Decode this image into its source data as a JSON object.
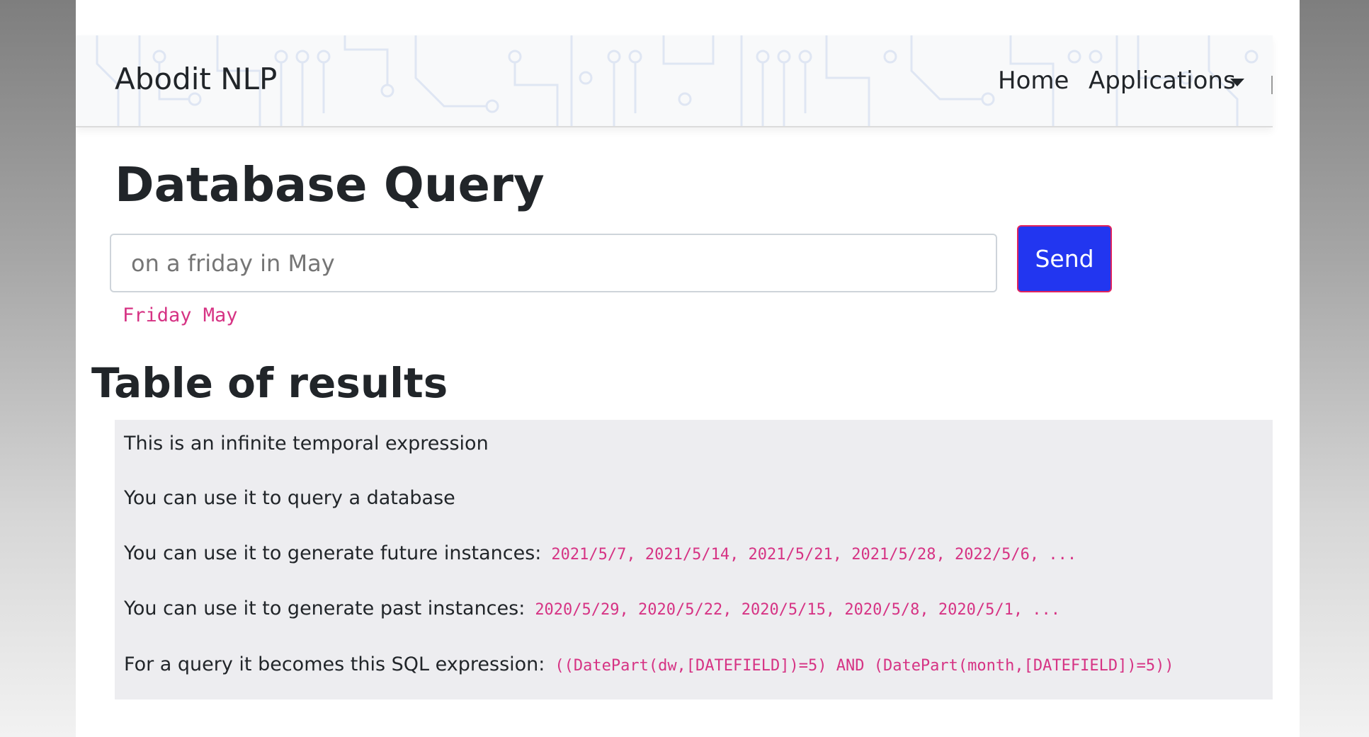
{
  "navbar": {
    "brand": "Abodit NLP",
    "home_label": "Home",
    "applications_label": "Applications"
  },
  "main": {
    "title": "Database Query",
    "query_input": {
      "value": "",
      "placeholder": "on a friday in May"
    },
    "send_label": "Send",
    "parse_result": "Friday May"
  },
  "results": {
    "title": "Table of results",
    "lines": [
      {
        "text": "This is an infinite temporal expression",
        "code": ""
      },
      {
        "text": "You can use it to query a database",
        "code": ""
      },
      {
        "text": "You can use it to generate future instances:",
        "code": "2021/5/7, 2021/5/14, 2021/5/21, 2021/5/28, 2022/5/6, ..."
      },
      {
        "text": "You can use it to generate past instances:",
        "code": "2020/5/29, 2020/5/22, 2020/5/15, 2020/5/8, 2020/5/1, ..."
      },
      {
        "text": "For a query it becomes this SQL expression:",
        "code": "((DatePart(dw,[DATEFIELD])=5) AND (DatePart(month,[DATEFIELD])=5))"
      }
    ]
  },
  "colors": {
    "primary_button": "#2236f0",
    "code_text": "#d63384",
    "results_background": "#ededf0"
  }
}
